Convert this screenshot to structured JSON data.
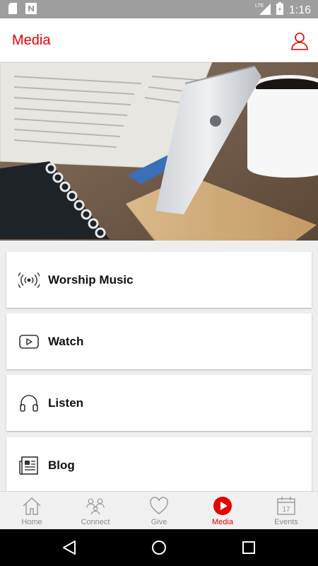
{
  "status_bar": {
    "time": "1:16",
    "network": "LTE"
  },
  "app_bar": {
    "title": "Media"
  },
  "menu": {
    "items": [
      {
        "label": "Worship Music",
        "icon": "broadcast-icon"
      },
      {
        "label": "Watch",
        "icon": "play-video-icon"
      },
      {
        "label": "Listen",
        "icon": "headphones-icon"
      },
      {
        "label": "Blog",
        "icon": "newspaper-icon"
      }
    ]
  },
  "bottom_nav": {
    "items": [
      {
        "label": "Home",
        "icon": "home-icon"
      },
      {
        "label": "Connect",
        "icon": "people-icon"
      },
      {
        "label": "Give",
        "icon": "heart-icon"
      },
      {
        "label": "Media",
        "icon": "media-play-icon",
        "active": true
      },
      {
        "label": "Events",
        "icon": "calendar-icon",
        "day": "17"
      }
    ]
  },
  "colors": {
    "accent": "#e60000",
    "nav_inactive": "#8a8a8a",
    "status_bar": "#9e9e9e"
  }
}
